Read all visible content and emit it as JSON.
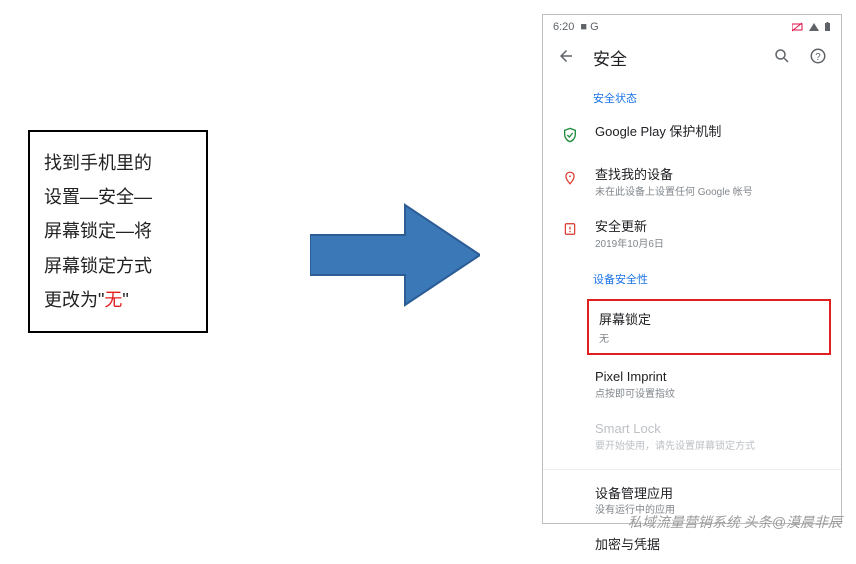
{
  "instruction": {
    "line1": "找到手机里的",
    "line2": "设置—安全—",
    "line3": "屏幕锁定—将",
    "line4": "屏幕锁定方式",
    "line5_a": "更改为\"",
    "line5_red": "无",
    "line5_b": "\""
  },
  "status": {
    "time": "6:20",
    "icons_left": "■ G"
  },
  "header": {
    "title": "安全"
  },
  "sections": {
    "status_header": "安全状态",
    "device_header": "设备安全性"
  },
  "rows": {
    "play_protect": {
      "title": "Google Play 保护机制"
    },
    "find_device": {
      "title": "查找我的设备",
      "sub": "未在此设备上设置任何 Google 帐号"
    },
    "update": {
      "title": "安全更新",
      "sub": "2019年10月6日"
    },
    "screen_lock": {
      "title": "屏幕锁定",
      "sub": "无"
    },
    "pixel_imprint": {
      "title": "Pixel Imprint",
      "sub": "点按即可设置指纹"
    },
    "smart_lock": {
      "title": "Smart Lock",
      "sub": "要开始使用，请先设置屏幕锁定方式"
    },
    "device_admin": {
      "title": "设备管理应用",
      "sub": "没有运行中的应用"
    },
    "encryption": {
      "title": "加密与凭据"
    }
  },
  "watermark": "私域流量营销系统 头条@漠晨非辰"
}
